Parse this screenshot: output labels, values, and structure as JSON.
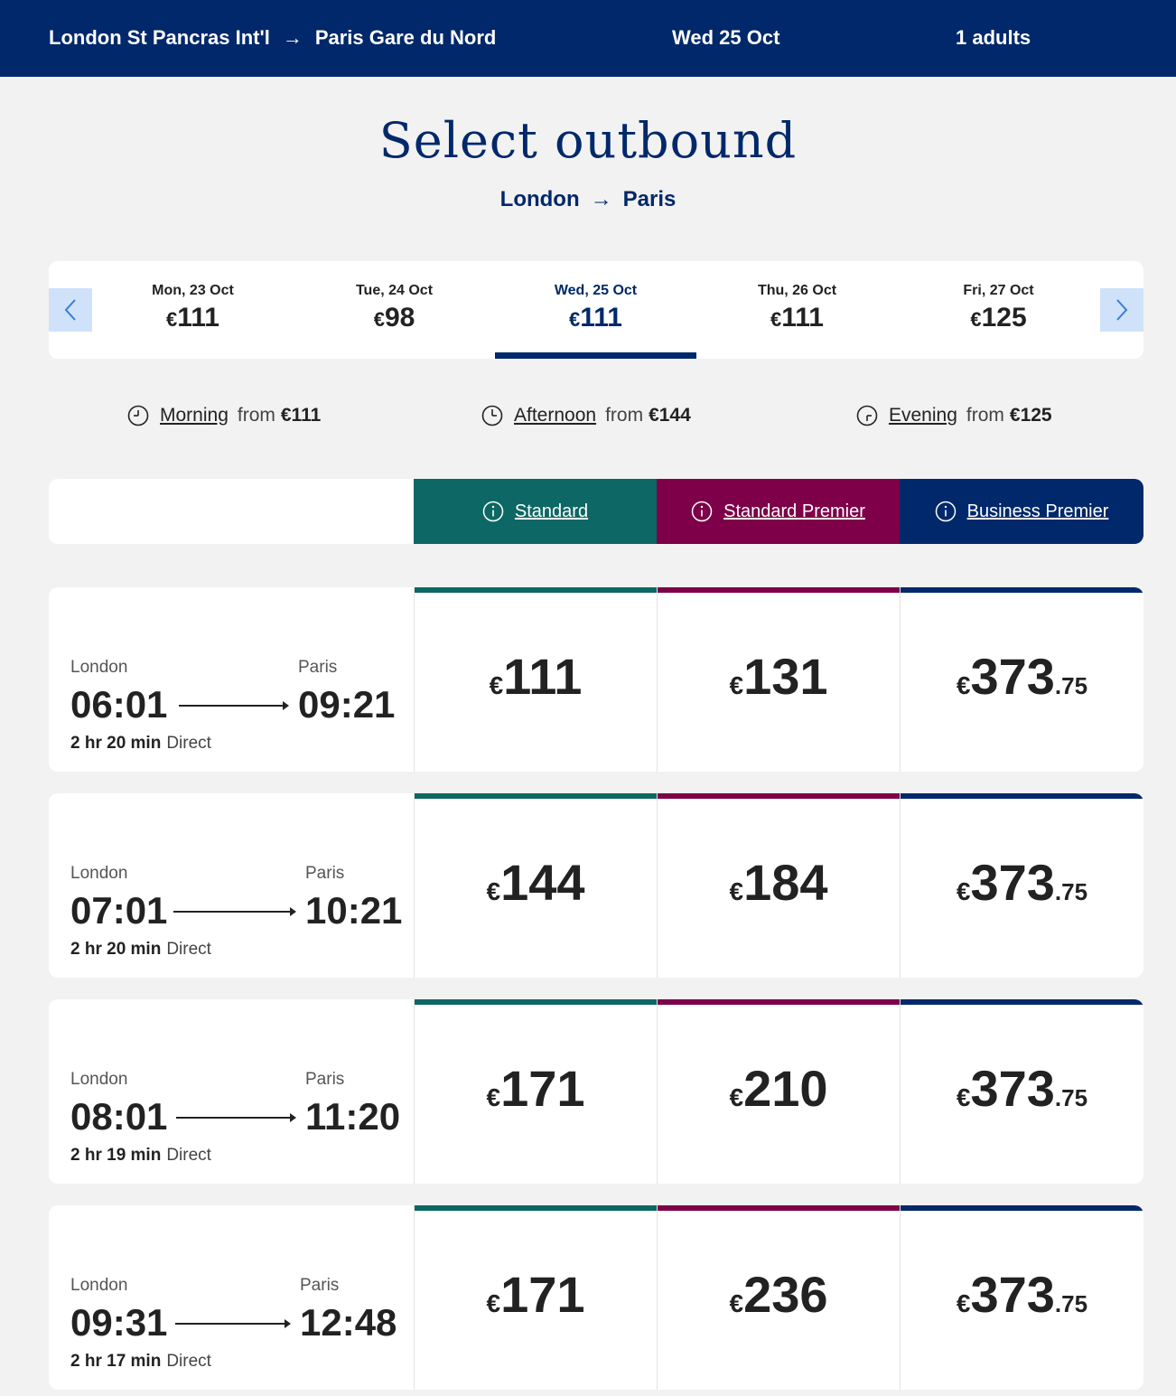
{
  "header": {
    "origin": "London St Pancras Int'l",
    "arrow": "→",
    "destination": "Paris Gare du Nord",
    "date": "Wed 25 Oct",
    "passengers": "1 adults"
  },
  "page_title": "Select outbound",
  "subroute": {
    "from": "London",
    "arrow": "→",
    "to": "Paris"
  },
  "date_selector": {
    "prev_icon": "chevron-left-icon",
    "next_icon": "chevron-right-icon",
    "days": [
      {
        "label": "Mon, 23 Oct",
        "currency": "€",
        "price": "111",
        "selected": false
      },
      {
        "label": "Tue, 24 Oct",
        "currency": "€",
        "price": "98",
        "selected": false
      },
      {
        "label": "Wed, 25 Oct",
        "currency": "€",
        "price": "111",
        "selected": true
      },
      {
        "label": "Thu, 26 Oct",
        "currency": "€",
        "price": "111",
        "selected": false
      },
      {
        "label": "Fri, 27 Oct",
        "currency": "€",
        "price": "125",
        "selected": false
      }
    ]
  },
  "time_of_day": [
    {
      "icon": "clock-morning-icon",
      "label": "Morning",
      "from": "from",
      "price": "€111"
    },
    {
      "icon": "clock-afternoon-icon",
      "label": "Afternoon",
      "from": "from",
      "price": "€144"
    },
    {
      "icon": "clock-evening-icon",
      "label": "Evening",
      "from": "from",
      "price": "€125"
    }
  ],
  "classes": [
    {
      "label": "Standard",
      "icon": "info-icon",
      "color": "#0d6764"
    },
    {
      "label": "Standard Premier",
      "icon": "info-icon",
      "color": "#7d0048"
    },
    {
      "label": "Business Premier",
      "icon": "info-icon",
      "color": "#00286a"
    }
  ],
  "journeys": [
    {
      "from_city": "London",
      "to_city": "Paris",
      "depart": "06:01",
      "arrive": "09:21",
      "duration": "2 hr 20 min",
      "type": "Direct",
      "fares": [
        {
          "currency": "€",
          "int": "111",
          "dec": ""
        },
        {
          "currency": "€",
          "int": "131",
          "dec": ""
        },
        {
          "currency": "€",
          "int": "373",
          "dec": ".75"
        }
      ]
    },
    {
      "from_city": "London",
      "to_city": "Paris",
      "depart": "07:01",
      "arrive": "10:21",
      "duration": "2 hr 20 min",
      "type": "Direct",
      "fares": [
        {
          "currency": "€",
          "int": "144",
          "dec": ""
        },
        {
          "currency": "€",
          "int": "184",
          "dec": ""
        },
        {
          "currency": "€",
          "int": "373",
          "dec": ".75"
        }
      ]
    },
    {
      "from_city": "London",
      "to_city": "Paris",
      "depart": "08:01",
      "arrive": "11:20",
      "duration": "2 hr 19 min",
      "type": "Direct",
      "fares": [
        {
          "currency": "€",
          "int": "171",
          "dec": ""
        },
        {
          "currency": "€",
          "int": "210",
          "dec": ""
        },
        {
          "currency": "€",
          "int": "373",
          "dec": ".75"
        }
      ]
    },
    {
      "from_city": "London",
      "to_city": "Paris",
      "depart": "09:31",
      "arrive": "12:48",
      "duration": "2 hr 17 min",
      "type": "Direct",
      "fares": [
        {
          "currency": "€",
          "int": "171",
          "dec": ""
        },
        {
          "currency": "€",
          "int": "236",
          "dec": ""
        },
        {
          "currency": "€",
          "int": "373",
          "dec": ".75"
        }
      ]
    }
  ]
}
